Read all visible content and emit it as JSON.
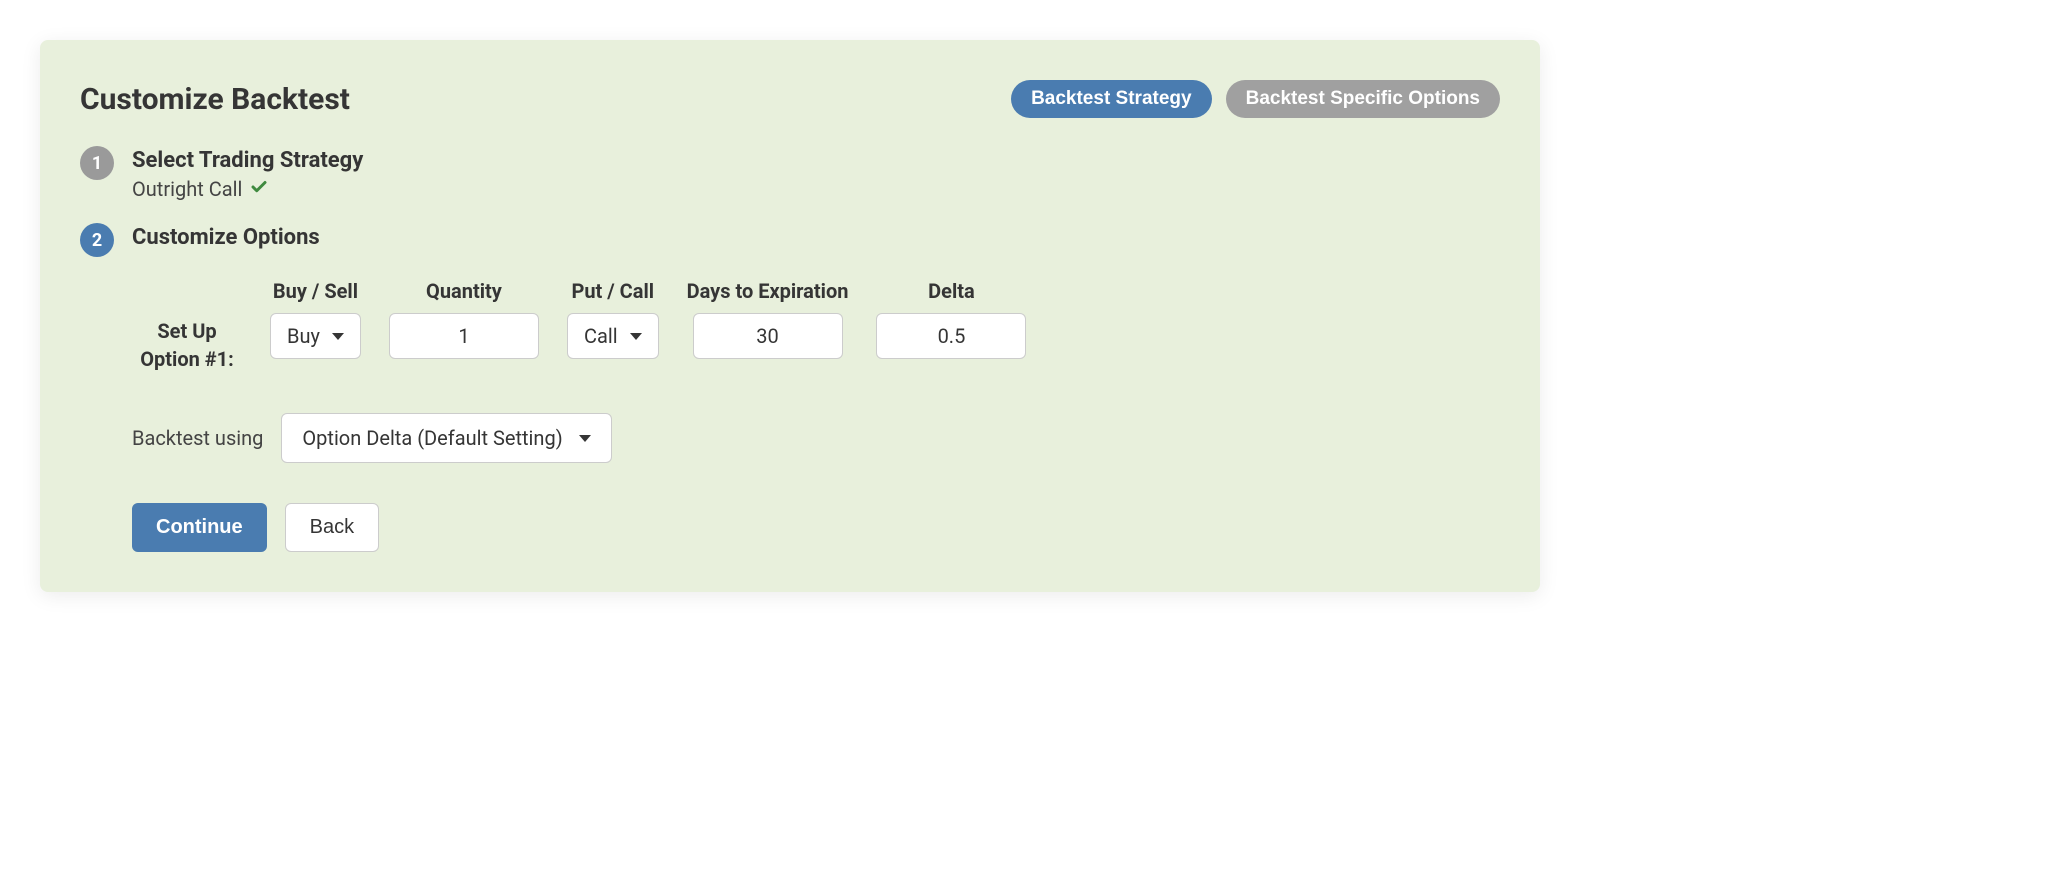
{
  "header": {
    "title": "Customize Backtest",
    "tabs": {
      "active": "Backtest Strategy",
      "inactive": "Backtest Specific Options"
    }
  },
  "steps": {
    "step1": {
      "number": "1",
      "title": "Select Trading Strategy",
      "selected": "Outright Call"
    },
    "step2": {
      "number": "2",
      "title": "Customize Options"
    }
  },
  "setup": {
    "label_line1": "Set Up",
    "label_line2": "Option #1:",
    "fields": {
      "buysell": {
        "label": "Buy / Sell",
        "value": "Buy"
      },
      "quantity": {
        "label": "Quantity",
        "value": "1"
      },
      "putcall": {
        "label": "Put / Call",
        "value": "Call"
      },
      "days": {
        "label": "Days to Expiration",
        "value": "30"
      },
      "delta": {
        "label": "Delta",
        "value": "0.5"
      }
    }
  },
  "backtest_using": {
    "label": "Backtest using",
    "value": "Option Delta (Default Setting)"
  },
  "buttons": {
    "continue": "Continue",
    "back": "Back"
  }
}
